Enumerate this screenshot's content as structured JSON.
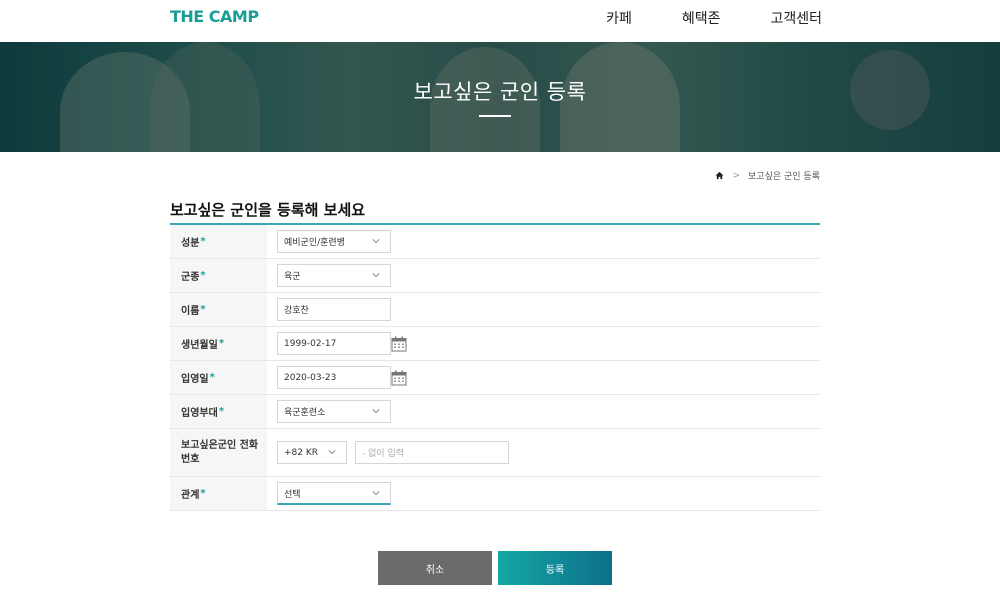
{
  "header": {
    "logo": "THE CAMP",
    "nav": [
      "카페",
      "혜택존",
      "고객센터"
    ]
  },
  "hero": {
    "title": "보고싶은 군인 등록"
  },
  "breadcrumb": {
    "current": "보고싶은 군인 등록"
  },
  "form": {
    "title": "보고싶은 군인을 등록해 보세요",
    "rows": {
      "status": {
        "label": "성분",
        "required": "*",
        "value": "예비군인/훈련병"
      },
      "branch": {
        "label": "군종",
        "required": "*",
        "value": "육군"
      },
      "name": {
        "label": "이름",
        "required": "*",
        "value": "강호찬"
      },
      "birth": {
        "label": "생년월일",
        "required": "*",
        "value": "1999-02-17"
      },
      "enlist": {
        "label": "입영일",
        "required": "*",
        "value": "2020-03-23"
      },
      "unit": {
        "label": "입영부대",
        "required": "*",
        "value": "육군훈련소"
      },
      "phone": {
        "label": "보고싶은군인 전화번호",
        "country": "+82 KR",
        "placeholder": "- 없이 입력"
      },
      "relation": {
        "label": "관계",
        "required": "*",
        "value": "선택"
      }
    }
  },
  "buttons": {
    "cancel": "취소",
    "submit": "등록"
  },
  "colors": {
    "accent": "#1a9d96",
    "rule": "#3aa7b1",
    "cancel": "#6b6b6b"
  },
  "icons": [
    "home-icon",
    "chevron-down-icon",
    "calendar-icon"
  ]
}
